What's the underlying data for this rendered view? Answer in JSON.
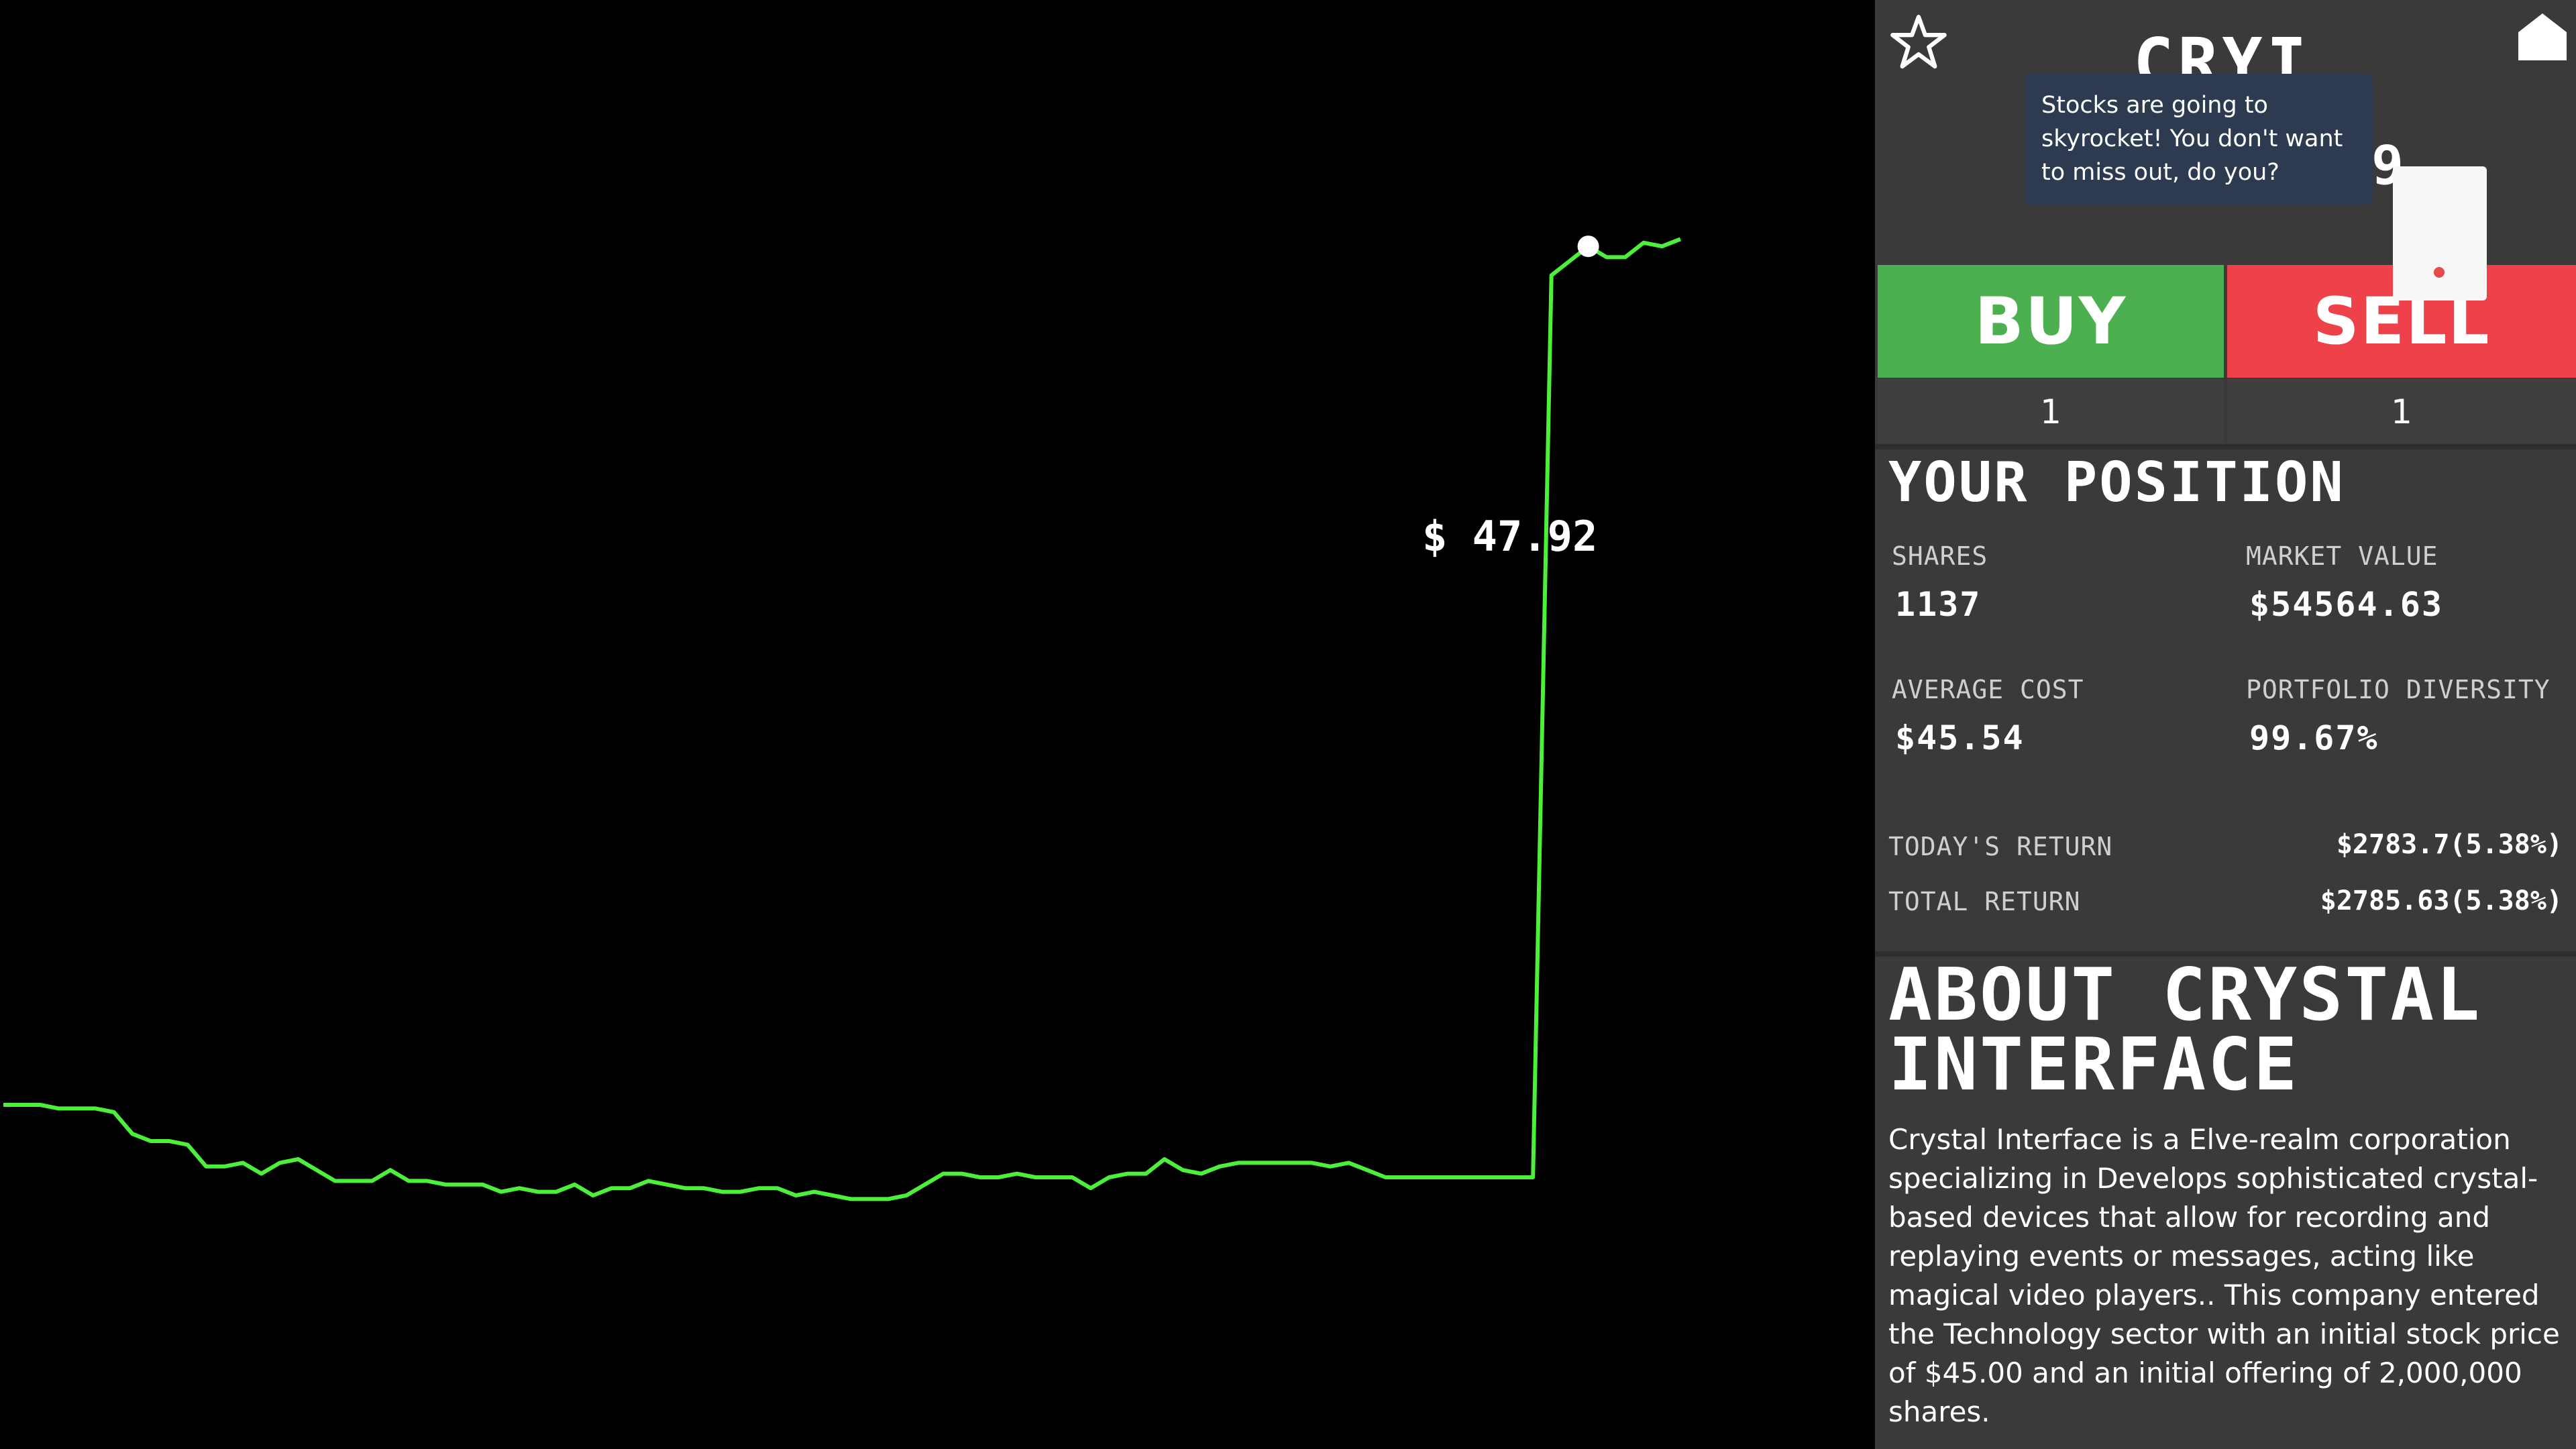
{
  "chart": {
    "current_price_label": "$ 47.92",
    "line_color": "#4cf03a",
    "marker_color": "#ffffff"
  },
  "chart_data": {
    "type": "line",
    "title": "",
    "xlabel": "",
    "ylabel": "",
    "ylim": [
      44.6,
      48.6
    ],
    "x": [
      0,
      1,
      2,
      3,
      4,
      5,
      6,
      7,
      8,
      9,
      10,
      11,
      12,
      13,
      14,
      15,
      16,
      17,
      18,
      19,
      20,
      21,
      22,
      23,
      24,
      25,
      26,
      27,
      28,
      29,
      30,
      31,
      32,
      33,
      34,
      35,
      36,
      37,
      38,
      39,
      40,
      41,
      42,
      43,
      44,
      45,
      46,
      47,
      48,
      49,
      50,
      51,
      52,
      53,
      54,
      55,
      56,
      57,
      58,
      59,
      60,
      61,
      62,
      63,
      64,
      65,
      66,
      67,
      68,
      69,
      70,
      71,
      72,
      73,
      74,
      75,
      76,
      77,
      78,
      79,
      80,
      81,
      82,
      83,
      84,
      85,
      86,
      87,
      88,
      89,
      90,
      91
    ],
    "series": [
      {
        "values": [
          45.55,
          45.55,
          45.55,
          45.54,
          45.54,
          45.54,
          45.53,
          45.47,
          45.45,
          45.45,
          45.44,
          45.38,
          45.38,
          45.39,
          45.36,
          45.39,
          45.4,
          45.37,
          45.34,
          45.34,
          45.34,
          45.37,
          45.34,
          45.34,
          45.33,
          45.33,
          45.33,
          45.31,
          45.32,
          45.31,
          45.31,
          45.33,
          45.3,
          45.32,
          45.32,
          45.34,
          45.33,
          45.32,
          45.32,
          45.31,
          45.31,
          45.32,
          45.32,
          45.3,
          45.31,
          45.3,
          45.29,
          45.29,
          45.29,
          45.3,
          45.33,
          45.36,
          45.36,
          45.35,
          45.35,
          45.36,
          45.35,
          45.35,
          45.35,
          45.32,
          45.35,
          45.36,
          45.36,
          45.4,
          45.37,
          45.36,
          45.38,
          45.39,
          45.39,
          45.39,
          45.39,
          45.39,
          45.38,
          45.39,
          45.37,
          45.35,
          45.35,
          45.35,
          45.35,
          45.35,
          45.35,
          45.35,
          45.35,
          45.35,
          47.84,
          47.88,
          47.92,
          47.89,
          47.89,
          47.93,
          47.92,
          47.94
        ]
      }
    ]
  },
  "header": {
    "ticker": "CRYI",
    "ticker_fragment": "9",
    "tooltip": "Stocks are going to skyrocket! You don't want to miss out, do you?"
  },
  "icons": {
    "favorite": "star-outline-icon",
    "home": "home-icon"
  },
  "trade": {
    "buy_label": "BUY",
    "sell_label": "SELL",
    "buy_qty": "1",
    "sell_qty": "1",
    "buy_color": "#4cb050",
    "sell_color": "#ee4149"
  },
  "position": {
    "title": "YOUR POSITION",
    "shares_label": "SHARES",
    "shares_value": "1137",
    "market_value_label": "MARKET VALUE",
    "market_value": "$54564.63",
    "avg_cost_label": "AVERAGE COST",
    "avg_cost_value": "$45.54",
    "diversity_label": "PORTFOLIO DIVERSITY",
    "diversity_value": "99.67%",
    "todays_return_label": "TODAY'S RETURN",
    "todays_return_value": "$2783.7(5.38%)",
    "total_return_label": "TOTAL RETURN",
    "total_return_value": "$2785.63(5.38%)"
  },
  "about": {
    "title": "ABOUT CRYSTAL INTERFACE",
    "text": "Crystal Interface is a Elve-realm corporation specializing in Develops sophisticated crystal-based devices that allow for recording and replaying events or messages, acting like magical video players.. This company entered the Technology sector with an initial stock price of $45.00 and an initial offering of 2,000,000 shares."
  }
}
